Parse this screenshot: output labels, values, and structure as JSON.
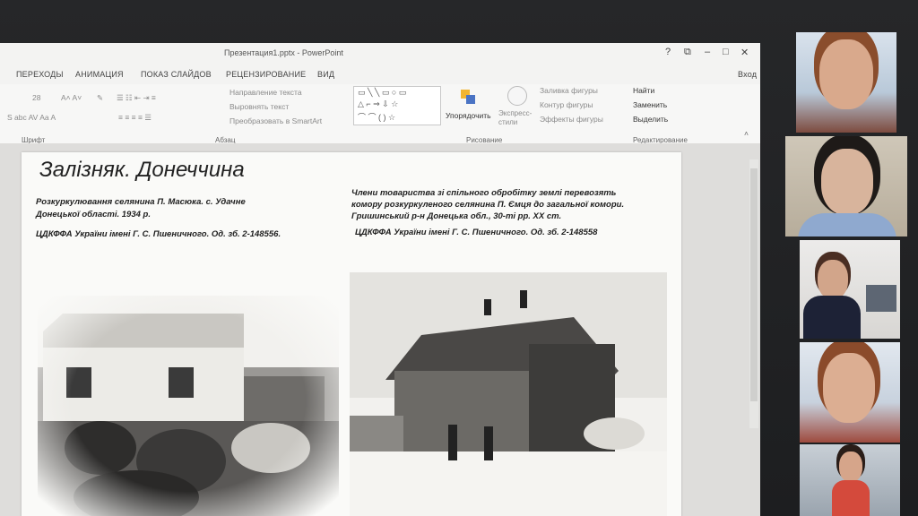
{
  "window": {
    "title": "Презентация1.pptx - PowerPoint",
    "buttons": [
      "?",
      "⧉",
      "–",
      "□",
      "✕"
    ],
    "login": "Вход"
  },
  "tabs": [
    "ПЕРЕХОДЫ",
    "АНИМАЦИЯ",
    "ПОКАЗ СЛАЙДОВ",
    "РЕЦЕНЗИРОВАНИЕ",
    "ВИД"
  ],
  "ribbon": {
    "font_size": "28",
    "text_direction": "Направление текста",
    "align_text": "Выровнять текст",
    "smartart": "Преобразовать в SmartArt",
    "arrange": "Упорядочить",
    "quick_styles": "Экспресс-стили",
    "shape_fill": "Заливка фигуры",
    "shape_outline": "Контур фигуры",
    "shape_effects": "Эффекты фигуры",
    "find": "Найти",
    "replace": "Заменить",
    "select": "Выделить",
    "groups": {
      "font": "Шрифт",
      "paragraph": "Абзац",
      "drawing": "Рисование",
      "editing": "Редактирование"
    }
  },
  "slide": {
    "title": "Залізняк. Донеччина",
    "caption_left_1": "Розкуркулювання селянина П. Масюка. с. Удачне",
    "caption_left_2": "Донецької області. 1934 р.",
    "source_left": "ЦДКФФА України імені Г. С. Пшеничного. Од. зб. 2-148556.",
    "caption_right_1": "Члени товариства зі спільного обробітку землі перевозять",
    "caption_right_2": "комору розкуркуленого селянина П. Ємця до загальної комори.",
    "caption_right_3": "Гришинський р-н Донецька обл., 30-ті рр. ХХ ст.",
    "source_right": "ЦДКФФА України імені Г. С. Пшеничного. Од. зб. 2-148558"
  }
}
